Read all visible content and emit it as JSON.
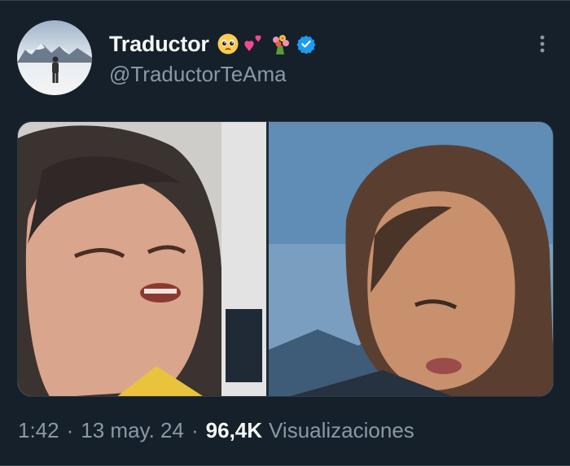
{
  "tweet": {
    "author": {
      "name": "Traductor",
      "handle": "@TraductorTeAma",
      "name_emojis": [
        "pleading-face-emoji",
        "two-hearts-emoji",
        "bouquet-emoji"
      ],
      "verified": true
    },
    "media": {
      "left_panel": "photo-man-eyes-closed",
      "right_panel": "photo-woman-looking-down"
    },
    "meta": {
      "time": "1:42",
      "separator": "·",
      "date": "13 may. 24",
      "views_count": "96,4K",
      "views_label": "Visualizaciones"
    }
  },
  "colors": {
    "background": "#15202b",
    "primary_text": "#f7f9f9",
    "secondary_text": "#8b98a5",
    "verified_badge": "#1d9bf0"
  }
}
